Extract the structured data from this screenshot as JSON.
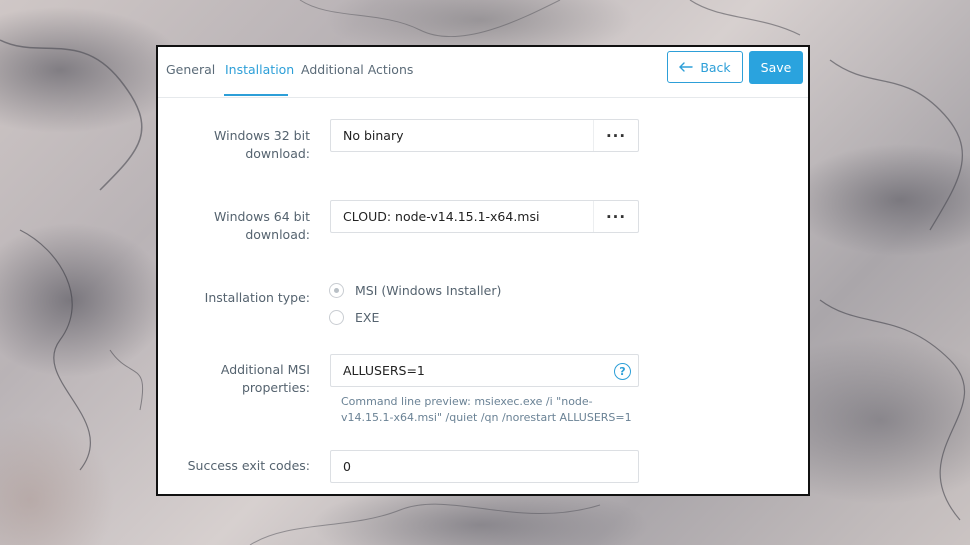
{
  "tabs": [
    {
      "label": "General",
      "active": false
    },
    {
      "label": "Installation",
      "active": true
    },
    {
      "label": "Additional Actions",
      "active": false
    }
  ],
  "header": {
    "back_label": "Back",
    "save_label": "Save"
  },
  "form": {
    "win32": {
      "label_line1": "Windows 32 bit",
      "label_line2": "download:",
      "value": "No binary"
    },
    "win64": {
      "label_line1": "Windows 64 bit",
      "label_line2": "download:",
      "value": "CLOUD: node-v14.15.1-x64.msi"
    },
    "install_type": {
      "label": "Installation type:",
      "options": [
        {
          "label": "MSI (Windows Installer)",
          "selected": true
        },
        {
          "label": "EXE",
          "selected": false
        }
      ]
    },
    "msi_props": {
      "label_line1": "Additional MSI",
      "label_line2": "properties:",
      "value": "ALLUSERS=1",
      "preview": "Command line preview:  msiexec.exe /i \"node-v14.15.1-x64.msi\"  /quiet /qn /norestart ALLUSERS=1"
    },
    "exit_codes": {
      "label": "Success exit codes:",
      "value": "0"
    }
  },
  "icons": {
    "back": "arrow-left-icon",
    "more": "ellipsis-icon",
    "help": "question-circle-icon"
  },
  "colors": {
    "accent": "#2d9fd8",
    "save_bg": "#2aa3de",
    "label_text": "#55636f"
  }
}
